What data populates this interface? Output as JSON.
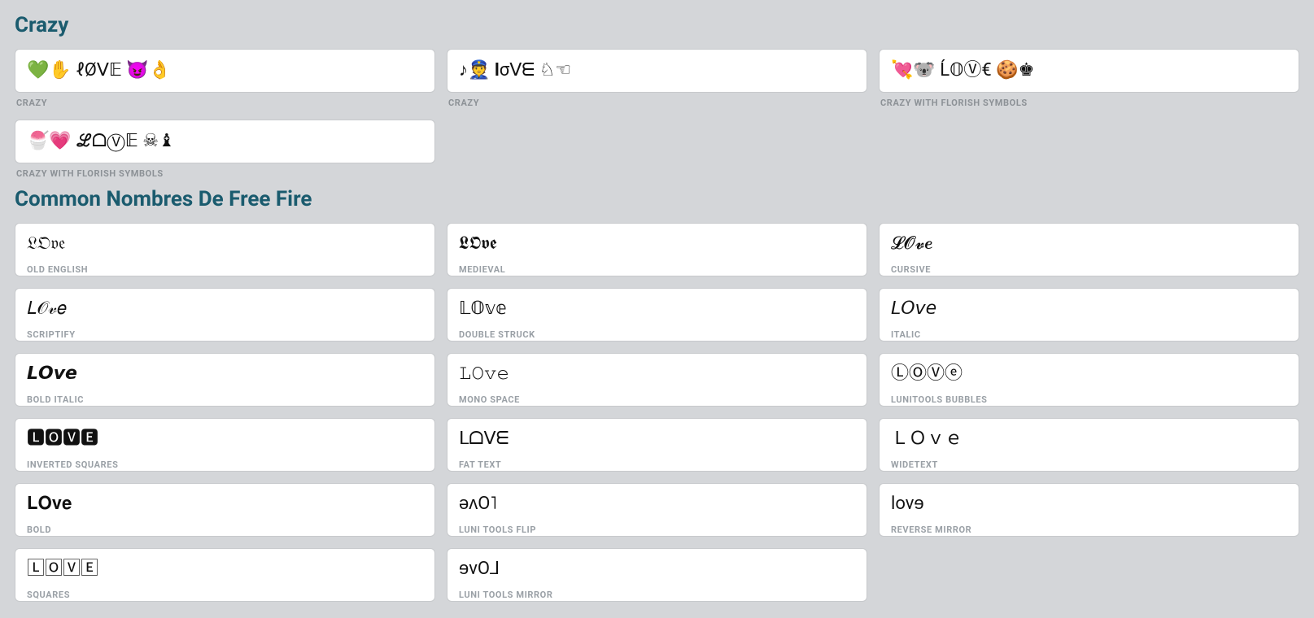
{
  "sections": {
    "crazy": {
      "title": "Crazy",
      "items": [
        {
          "value": "💚✋ ℓØᐯ𝔼 😈👌",
          "label": "CRAZY"
        },
        {
          "value": "♪👮 𝐥σᐯᗴ ♘☜",
          "label": "CRAZY"
        },
        {
          "value": "💘🐨 Ĺ𝕆Ⓥ€ 🍪♚",
          "label": "CRAZY WITH FLORISH SYMBOLS"
        },
        {
          "value": "🍧💗 ℒᗝⓋ𝔼 ☠♝",
          "label": "CRAZY WITH FLORISH SYMBOLS"
        }
      ]
    },
    "common": {
      "title": "Common Nombres De Free Fire",
      "items": [
        {
          "value": "𝔏𝔒𝔳𝔢",
          "label": "OLD ENGLISH"
        },
        {
          "value": "𝕷𝕺𝖛𝖊",
          "label": "MEDIEVAL"
        },
        {
          "value": "𝓛𝓞𝓿𝒆",
          "label": "CURSIVE"
        },
        {
          "value": "𝐿𝒪𝓋𝑒",
          "label": "SCRIPTIFY"
        },
        {
          "value": "𝕃𝕆𝕧𝕖",
          "label": "DOUBLE STRUCK"
        },
        {
          "value": "𝘓𝘖𝘷𝘦",
          "label": "ITALIC"
        },
        {
          "value": "𝙇𝙊𝙫𝙚",
          "label": "BOLD ITALIC"
        },
        {
          "value": "𝙻𝙾𝚟𝚎",
          "label": "MONO SPACE"
        },
        {
          "value": "ⓁⓄⓋⓔ",
          "label": "LUNITOOLS BUBBLES"
        },
        {
          "value": "🅻🅾🆅🅴",
          "label": "INVERTED SQUARES"
        },
        {
          "value": "ᒪᗝᐯᗴ",
          "label": "FAT TEXT"
        },
        {
          "value": "ＬＯｖｅ",
          "label": "WIDETEXT"
        },
        {
          "value": "𝐋𝐎𝐯𝐞",
          "label": "BOLD"
        },
        {
          "value": "ǝʌO˥",
          "label": "LUNI TOOLS FLIP"
        },
        {
          "value": "lovɘ",
          "label": "REVERSE MIRROR"
        },
        {
          "value": "🄻🄾🅅🄴",
          "label": "SQUARES"
        },
        {
          "value": "ɘvO⅃",
          "label": "LUNI TOOLS MIRROR"
        }
      ]
    }
  }
}
